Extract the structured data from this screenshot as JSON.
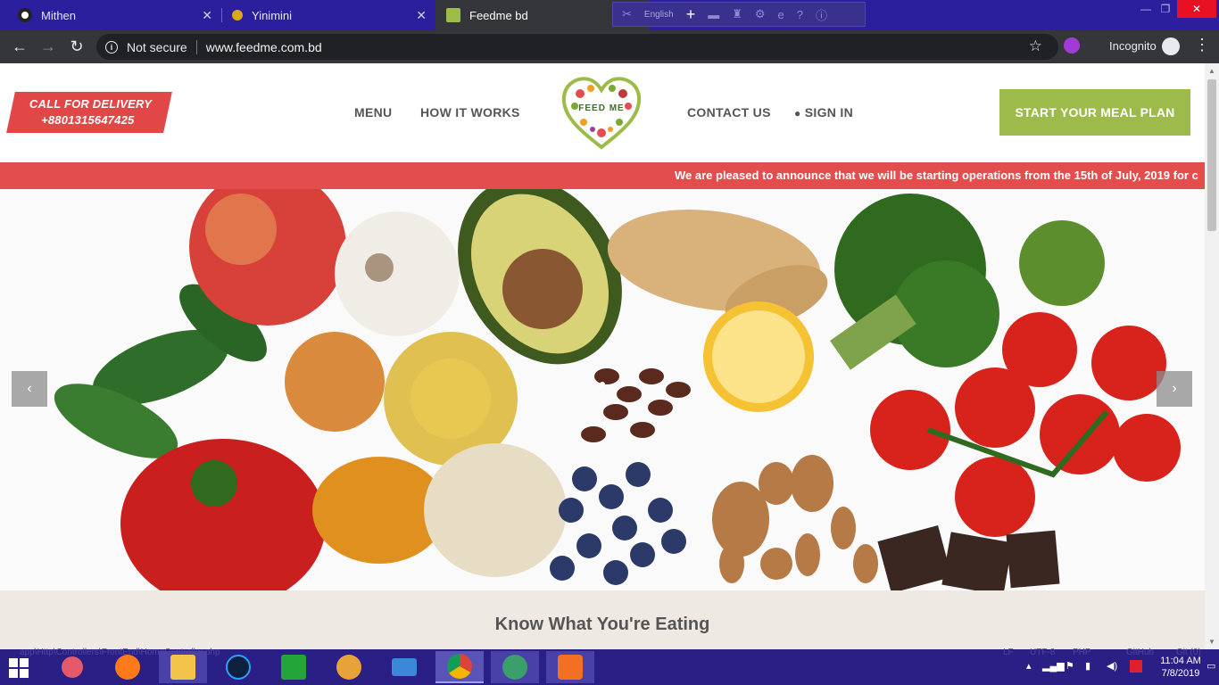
{
  "browser": {
    "tabs": [
      {
        "title": "Mithen",
        "close": "✕"
      },
      {
        "title": "Yinimini",
        "close": "✕"
      },
      {
        "title": "Feedme bd",
        "close": "✕"
      }
    ],
    "overlay_text": "English",
    "window_controls": {
      "minimize": "—",
      "maximize": "❐",
      "close": "✕"
    },
    "security_label": "Not secure",
    "url": "www.feedme.com.bd",
    "incognito_label": "Incognito"
  },
  "site": {
    "delivery_line1": "CALL FOR DELIVERY",
    "delivery_line2": "+8801315647425",
    "nav": {
      "menu": "MENU",
      "how_it_works": "HOW IT WORKS",
      "contact_us": "CONTACT US",
      "sign_in": "SIGN IN"
    },
    "logo_text": "FEED ME",
    "meal_plan_button": "START YOUR MEAL PLAN",
    "announcement": "We are pleased to announce that we will be starting operations from the 15th of July, 2019 for c",
    "carousel": {
      "prev": "‹",
      "next": "›"
    },
    "section_heading": "Know What You're Eating",
    "colors": {
      "accent_red": "#e34d4d",
      "accent_green": "#9cbb4a",
      "section_bg": "#efe9e3"
    }
  },
  "taskbar": {
    "ghost_path": "app\\Http\\Controllers\\FrontEnd\\HomeController.php",
    "ghost_status": [
      "LF",
      "UTF-8",
      "PHP",
      "GitHub",
      "Git (0)"
    ],
    "apps": [
      "start-icon",
      "snipping-tool-icon",
      "firefox-icon",
      "file-explorer-icon",
      "media-icon",
      "store-icon",
      "weather-icon",
      "remote-desktop-icon",
      "chrome-icon",
      "atom-icon",
      "xampp-icon"
    ],
    "time": "11:04 AM",
    "date": "7/8/2019"
  }
}
